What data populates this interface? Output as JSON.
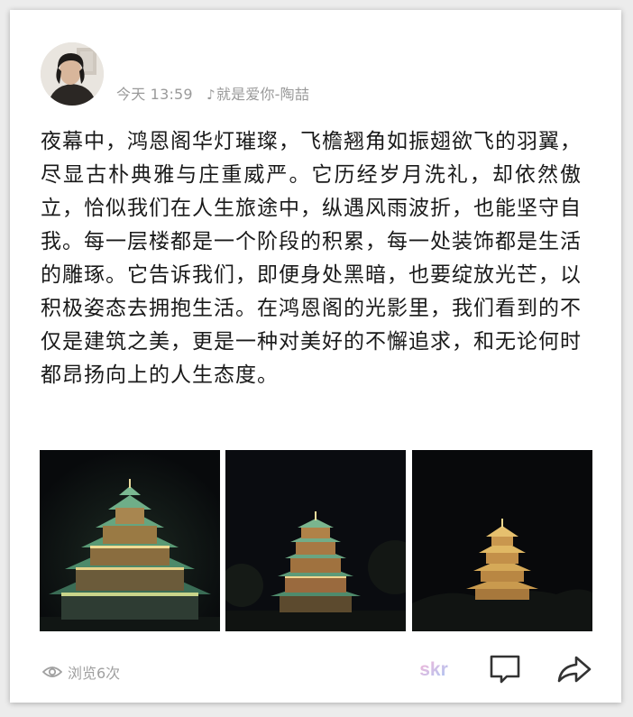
{
  "post": {
    "avatar_icon": "user-avatar",
    "time": "今天 13:59",
    "music_icon": "music-note-icon",
    "music": "就是爱你-陶喆",
    "text": "夜幕中，鸿恩阁华灯璀璨，飞檐翘角如振翅欲飞的羽翼，尽显古朴典雅与庄重威严。它历经岁月洗礼，却依然傲立，恰似我们在人生旅途中，纵遇风雨波折，也能坚守自我。每一层楼都是一个阶段的积累，每一处装饰都是生活的雕琢。它告诉我们，即便身处黑暗，也要绽放光芒，以积极姿态去拥抱生活。在鸿恩阁的光影里，我们看到的不仅是建筑之美，更是一种对美好的不懈追求，和无论何时都昂扬向上的人生态度。",
    "images": [
      {
        "icon": "night-pagoda-photo-close"
      },
      {
        "icon": "night-pagoda-photo-mid"
      },
      {
        "icon": "night-pagoda-photo-far"
      }
    ]
  },
  "footer": {
    "views": "浏览6次",
    "eye_icon": "eye-icon",
    "skr_label": "skr",
    "comment_icon": "comment-icon",
    "share_icon": "share-icon"
  },
  "colors": {
    "meta_text": "#9a9a9a",
    "body_text": "#1a1a1a",
    "skr_gradient": [
      "#f7b5d6",
      "#a9c7f5"
    ]
  }
}
